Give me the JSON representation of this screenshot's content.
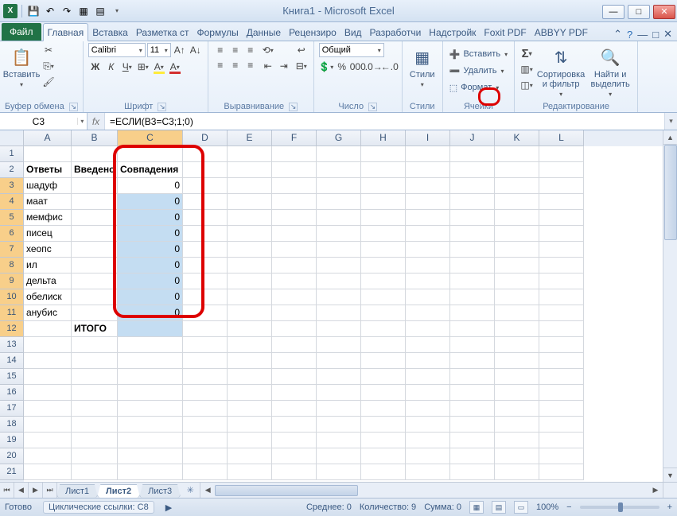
{
  "title": "Книга1 - Microsoft Excel",
  "tabs": {
    "file": "Файл",
    "list": [
      "Главная",
      "Вставка",
      "Разметка ст",
      "Формулы",
      "Данные",
      "Рецензиро",
      "Вид",
      "Разработчи",
      "Надстройк",
      "Foxit PDF",
      "ABBYY PDF"
    ],
    "active": 0
  },
  "groups": {
    "clipboard_title": "Буфер обмена",
    "paste": "Вставить",
    "font_title": "Шрифт",
    "font_name": "Calibri",
    "font_size": "11",
    "align_title": "Выравнивание",
    "number_title": "Число",
    "number_format": "Общий",
    "styles_title": "Стили",
    "styles": "Стили",
    "cells_title": "Ячейки",
    "insert": "Вставить",
    "delete": "Удалить",
    "format": "Формат",
    "editing_title": "Редактирование",
    "sort": "Сортировка и фильтр",
    "find": "Найти и выделить"
  },
  "formula_bar": {
    "name_box": "C3",
    "formula": "=ЕСЛИ(B3=C3;1;0)"
  },
  "columns": [
    "A",
    "B",
    "C",
    "D",
    "E",
    "F",
    "G",
    "H",
    "I",
    "J",
    "K",
    "L"
  ],
  "rows_shown": 21,
  "table": {
    "headers": {
      "A": "Ответы",
      "B": "Введено",
      "C": "Совпадения"
    },
    "col_a": [
      "шадуф",
      "маат",
      "мемфис",
      "писец",
      "хеопс",
      "ил",
      "дельта",
      "обелиск",
      "анубис"
    ],
    "itogo": "ИТОГО",
    "c_val": "0"
  },
  "sheets": {
    "list": [
      "Лист1",
      "Лист2",
      "Лист3"
    ],
    "active": 1
  },
  "status": {
    "ready": "Готово",
    "circ": "Циклические ссылки: C8",
    "avg": "Среднее: 0",
    "count": "Количество: 9",
    "sum": "Сумма: 0",
    "zoom": "100%"
  },
  "colors": {
    "select_bg": "#c4ddf2",
    "highlight": "#d00"
  }
}
